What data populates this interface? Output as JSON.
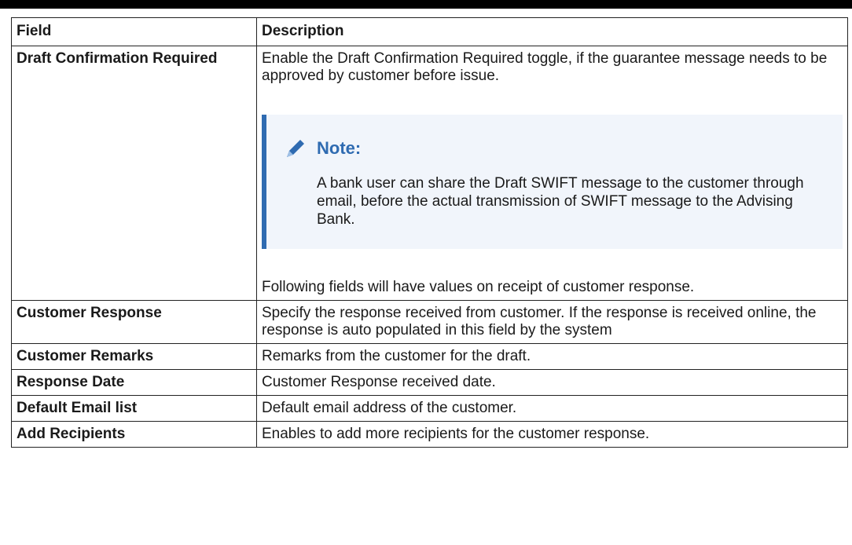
{
  "table": {
    "headers": {
      "field": "Field",
      "description": "Description"
    },
    "draft_confirmation": {
      "field": "Draft Confirmation Required",
      "description": "Enable the Draft Confirmation Required toggle, if the guarantee message needs to be approved by customer before issue.",
      "note": {
        "title": "Note:",
        "text": "A bank user can share the Draft SWIFT message to the customer through email, before the actual transmission of SWIFT message to the Advising Bank."
      },
      "following_text": "Following fields will have values on receipt of customer response."
    },
    "rows": [
      {
        "field": "Customer Response",
        "description": "Specify the response received from customer. If the response is received online, the response is auto populated in this field by the system"
      },
      {
        "field": "Customer Remarks",
        "description": "Remarks from the customer for the draft."
      },
      {
        "field": "Response Date",
        "description": "Customer Response received date."
      },
      {
        "field": "Default Email list",
        "description": "Default email address of the customer."
      },
      {
        "field": "Add Recipients",
        "description": "Enables to add more recipients for the customer response."
      }
    ]
  },
  "icons": {
    "note": "pencil-icon"
  },
  "colors": {
    "note_accent": "#2f6bb1",
    "note_background": "#f1f5fb"
  }
}
